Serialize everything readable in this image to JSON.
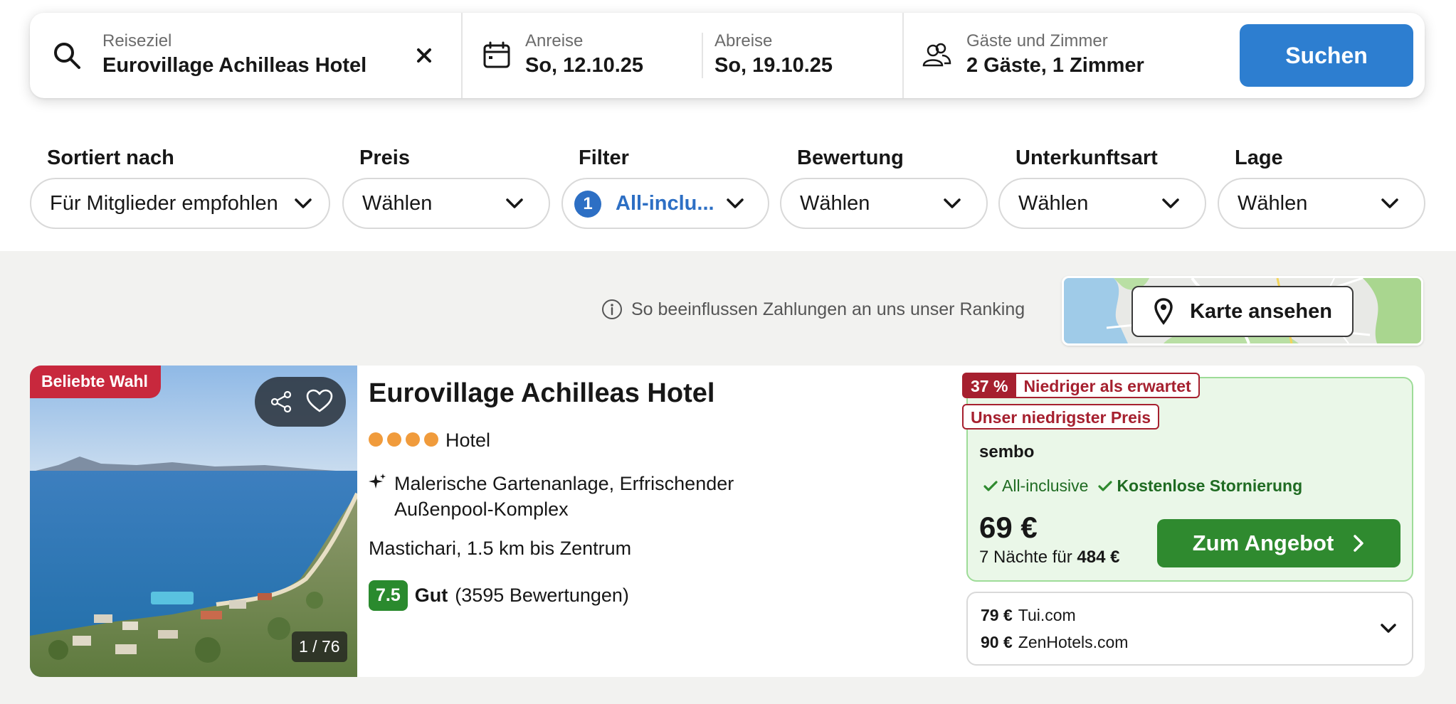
{
  "search": {
    "destination_label": "Reiseziel",
    "destination_value": "Eurovillage Achilleas Hotel",
    "checkin_label": "Anreise",
    "checkin_value": "So, 12.10.25",
    "checkout_label": "Abreise",
    "checkout_value": "So, 19.10.25",
    "guests_label": "Gäste und Zimmer",
    "guests_value": "2 Gäste, 1 Zimmer",
    "search_button": "Suchen"
  },
  "filters": {
    "sort": {
      "label": "Sortiert nach",
      "value": "Für Mitglieder empfohlen"
    },
    "price": {
      "label": "Preis",
      "value": "Wählen"
    },
    "filter": {
      "label": "Filter",
      "value": "All-inclu...",
      "count": "1"
    },
    "rating": {
      "label": "Bewertung",
      "value": "Wählen"
    },
    "property_type": {
      "label": "Unterkunftsart",
      "value": "Wählen"
    },
    "location": {
      "label": "Lage",
      "value": "Wählen"
    }
  },
  "ranking_info": "So beeinflussen Zahlungen an uns unser Ranking",
  "map_button": "Karte ansehen",
  "hotel": {
    "badge": "Beliebte Wahl",
    "photo_counter": "1 / 76",
    "name": "Eurovillage Achilleas Hotel",
    "stars": 4,
    "type": "Hotel",
    "highlights": "Malerische Gartenanlage, Erfrischender Außenpool-Komplex",
    "location": "Mastichari, 1.5 km bis Zentrum",
    "score": "7.5",
    "rating_word": "Gut",
    "reviews": "(3595 Bewertungen)",
    "offer": {
      "discount_pct": "37 %",
      "discount_text": "Niedriger als erwartet",
      "lowest_price_tag": "Unser niedrigster Preis",
      "provider": "sembo",
      "feature_1": "All-inclusive",
      "feature_2": "Kostenlose Stornierung",
      "price": "69 €",
      "nights_text": "7 Nächte für",
      "total_price": "484 €",
      "button": "Zum Angebot"
    },
    "alternatives": [
      {
        "price": "79 €",
        "provider": "Tui.com"
      },
      {
        "price": "90 €",
        "provider": "ZenHotels.com"
      }
    ]
  },
  "colors": {
    "primary_blue": "#2d7ed0",
    "deal_red": "#a6202f",
    "offer_green": "#2f8a2f",
    "score_green": "#2a8a2e",
    "star_orange": "#f09b3c"
  },
  "icons": [
    "search-icon",
    "close-icon",
    "calendar-icon",
    "guests-icon",
    "chevron-down-icon",
    "info-icon",
    "map-pin-icon",
    "share-icon",
    "heart-icon",
    "sparkle-icon",
    "check-icon",
    "chevron-right-icon"
  ]
}
